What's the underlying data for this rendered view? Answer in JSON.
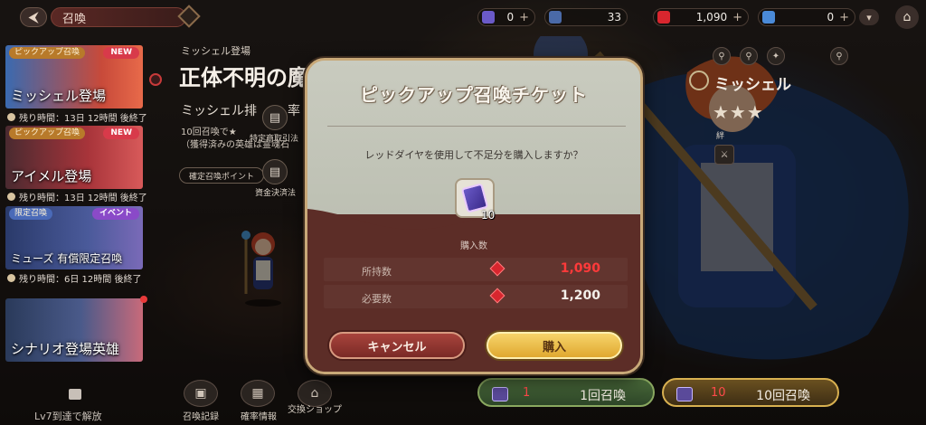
{
  "header": {
    "back_icon": "arrow-left-icon",
    "title": "召喚",
    "currencies": [
      {
        "icon": "ticket-icon",
        "color": "#6a5ac8",
        "value": "0",
        "plus": "+"
      },
      {
        "icon": "cube-icon",
        "color": "#4a6aa8",
        "value": "33",
        "plus": ""
      },
      {
        "icon": "red-diamond-icon",
        "color": "#d8262e",
        "value": "1,090",
        "plus": "+"
      },
      {
        "icon": "blue-gem-icon",
        "color": "#4a8ad8",
        "value": "0",
        "plus": "+"
      }
    ]
  },
  "banners": [
    {
      "tag": "ピックアップ召喚",
      "badge": "NEW",
      "name": "ミッシェル登場",
      "remaining": "残り時間：13日 12時間 後終了"
    },
    {
      "tag": "ピックアップ召喚",
      "badge": "NEW",
      "name": "アイメル登場",
      "remaining": "残り時間：13日 12時間 後終了"
    },
    {
      "tag": "限定召喚",
      "badge": "イベント",
      "name": "ミューズ 有償限定召喚",
      "remaining": "残り時間：6日 12時間 後終了"
    },
    {
      "tag": "",
      "badge": "",
      "name": "シナリオ登場英雄",
      "remaining": ""
    }
  ],
  "locked": {
    "text": "Lv7到達で解放"
  },
  "event": {
    "kicker": "ミッシェル登場",
    "title": "正体不明の魔",
    "subtitle": "ミッシェル排",
    "subtitle_tail": "率",
    "desc_line1": "10回召喚で★",
    "desc_line2": "（獲得済みの英雄は霊魂石",
    "point_button": "確定召喚ポイント",
    "side_buttons": [
      {
        "icon": "document-icon",
        "label": "特定商取引法"
      },
      {
        "icon": "document-icon",
        "label": "資金決済法"
      }
    ]
  },
  "character": {
    "name": "ミッシェル",
    "stars": "★★★",
    "bond_label": "絆"
  },
  "bottom_tools": [
    {
      "icon": "history-icon",
      "label": "召喚記録"
    },
    {
      "icon": "chart-icon",
      "label": "確率情報"
    },
    {
      "icon": "shop-icon",
      "label": "交換ショップ"
    }
  ],
  "summon_buttons": [
    {
      "count": "1",
      "label": "1回召喚"
    },
    {
      "count": "10",
      "label": "10回召喚"
    }
  ],
  "modal": {
    "title": "ピックアップ召喚チケット",
    "question": "レッドダイヤを使用して不足分を購入しますか？",
    "item_count": "10",
    "qty_label": "購入数",
    "rows": [
      {
        "label": "所持数",
        "value": "1,090",
        "color": "#ff3a3a"
      },
      {
        "label": "必要数",
        "value": "1,200",
        "color": "#f4f0ea"
      }
    ],
    "cancel_label": "キャンセル",
    "buy_label": "購入"
  }
}
